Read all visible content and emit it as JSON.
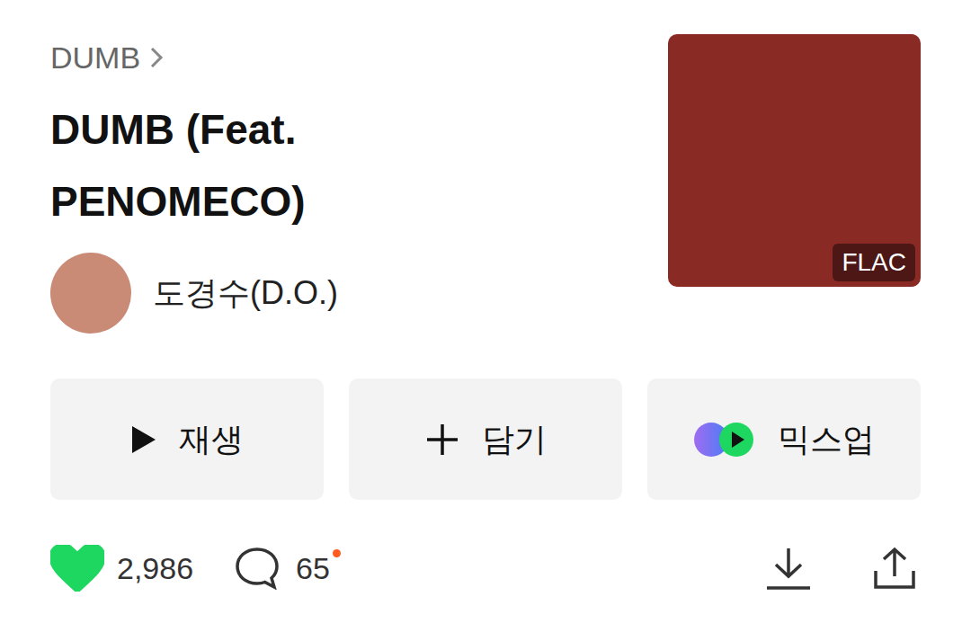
{
  "breadcrumb": {
    "label": "DUMB"
  },
  "song": {
    "title": "DUMB (Feat. PENOMECO)",
    "artist": "도경수(D.O.)"
  },
  "album_art": {
    "badge": "FLAC"
  },
  "buttons": [
    {
      "label": "재생",
      "kind": "play"
    },
    {
      "label": "담기",
      "kind": "add"
    },
    {
      "label": "믹스업",
      "kind": "mixup"
    }
  ],
  "stats": {
    "likes": "2,986",
    "liked": true,
    "comments": "65",
    "comments_new": true
  }
}
